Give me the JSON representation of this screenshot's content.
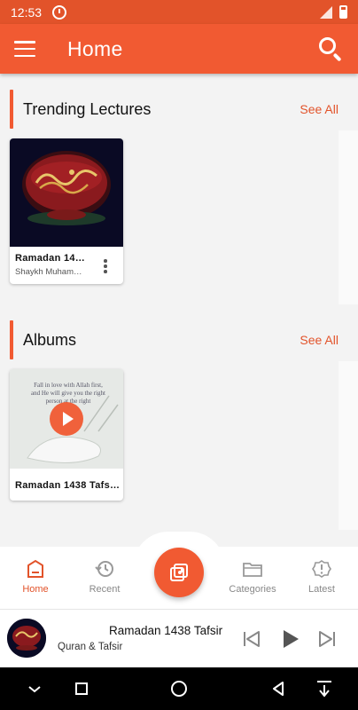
{
  "status_bar": {
    "time": "12:53"
  },
  "app_bar": {
    "title": "Home"
  },
  "sections": {
    "trending": {
      "title": "Trending Lectures",
      "see_all": "See All",
      "cards": [
        {
          "title": "Ramadan 14…",
          "subtitle": "Shaykh Muham…"
        }
      ]
    },
    "albums": {
      "title": "Albums",
      "see_all": "See All",
      "cards": [
        {
          "title": "Ramadan 1438 Tafs…",
          "image_text": "Fall in love with Allah first, and He will give you the right person at the right"
        }
      ]
    }
  },
  "bottom_nav": {
    "items": [
      {
        "label": "Home",
        "icon": "home-icon",
        "active": true
      },
      {
        "label": "Recent",
        "icon": "history-icon",
        "active": false
      },
      {
        "label": "Categories",
        "icon": "folder-icon",
        "active": false
      },
      {
        "label": "Latest",
        "icon": "alert-circle-icon",
        "active": false
      }
    ],
    "center_button": {
      "icon": "music-library-icon"
    }
  },
  "mini_player": {
    "title": "Ramadan 1438 Tafsir",
    "subtitle": "Quran & Tafsir"
  },
  "colors": {
    "primary": "#f15a32",
    "primary_dark": "#e2532a"
  }
}
